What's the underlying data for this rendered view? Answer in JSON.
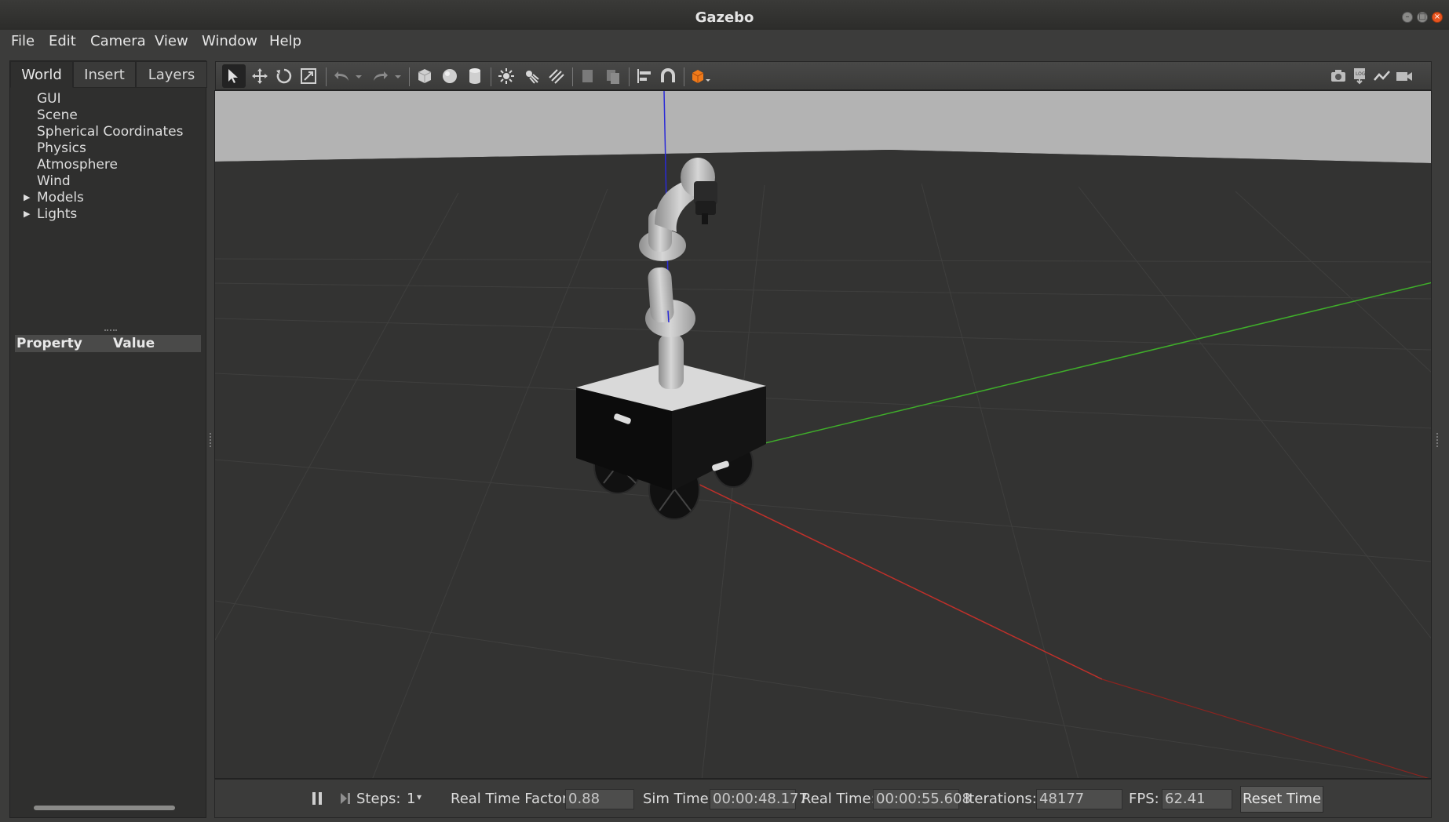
{
  "window": {
    "title": "Gazebo"
  },
  "menu": [
    "File",
    "Edit",
    "Camera",
    "View",
    "Window",
    "Help"
  ],
  "left_panel": {
    "tabs": [
      "World",
      "Insert",
      "Layers"
    ],
    "active_tab": "World",
    "tree": [
      {
        "label": "GUI",
        "expandable": false
      },
      {
        "label": "Scene",
        "expandable": false
      },
      {
        "label": "Spherical Coordinates",
        "expandable": false
      },
      {
        "label": "Physics",
        "expandable": false
      },
      {
        "label": "Atmosphere",
        "expandable": false
      },
      {
        "label": "Wind",
        "expandable": false
      },
      {
        "label": "Models",
        "expandable": true
      },
      {
        "label": "Lights",
        "expandable": true
      }
    ],
    "property_header": {
      "property": "Property",
      "value": "Value"
    }
  },
  "toolbar": {
    "tools": [
      "select-mode",
      "translate-mode",
      "rotate-mode",
      "scale-mode",
      "undo",
      "redo",
      "box-shape",
      "sphere-shape",
      "cylinder-shape",
      "point-light",
      "spot-light",
      "directional-light",
      "copy",
      "paste",
      "align",
      "snap",
      "view-angle"
    ],
    "right_tools": [
      "screenshot",
      "log",
      "plot",
      "record-video"
    ]
  },
  "bottom_bar": {
    "steps_label": "Steps:",
    "steps_value": "1",
    "rtf_label": "Real Time Factor:",
    "rtf_value": "0.88",
    "sim_label": "Sim Time:",
    "sim_value": "00:00:48.177",
    "real_label": "Real Time:",
    "real_value": "00:00:55.608",
    "iter_label": "Iterations:",
    "iter_value": "48177",
    "fps_label": "FPS:",
    "fps_value": "62.41",
    "reset_label": "Reset Time"
  },
  "colors": {
    "background": "#3c3c3b",
    "ground": "#333332",
    "sky": "#b3b3b3",
    "axis_x": "#c0302a",
    "axis_y": "#3fae2a",
    "axis_z": "#2a2ad8",
    "accent": "#f07a1a"
  }
}
